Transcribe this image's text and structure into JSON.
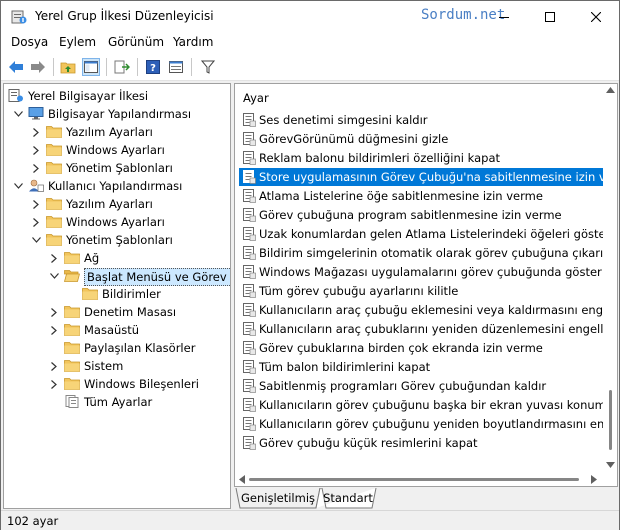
{
  "window": {
    "title": "Yerel Grup İlkesi Düzenleyicisi",
    "watermark": "Sordum.net"
  },
  "menu": [
    {
      "label": "Dosya"
    },
    {
      "label": "Eylem"
    },
    {
      "label": "Görünüm"
    },
    {
      "label": "Yardım"
    }
  ],
  "tree": {
    "items": [
      {
        "label": "Yerel Bilgisayar İlkesi"
      },
      {
        "label": "Bilgisayar Yapılandırması"
      },
      {
        "label": "Yazılım Ayarları"
      },
      {
        "label": "Windows Ayarları"
      },
      {
        "label": "Yönetim Şablonları"
      },
      {
        "label": "Kullanıcı Yapılandırması"
      },
      {
        "label": "Yazılım Ayarları"
      },
      {
        "label": "Windows Ayarları"
      },
      {
        "label": "Yönetim Şablonları"
      },
      {
        "label": "Ağ"
      },
      {
        "label": "Başlat Menüsü ve Görev Çubuğu"
      },
      {
        "label": "Bildirimler"
      },
      {
        "label": "Denetim Masası"
      },
      {
        "label": "Masaüstü"
      },
      {
        "label": "Paylaşılan Klasörler"
      },
      {
        "label": "Sistem"
      },
      {
        "label": "Windows Bileşenleri"
      },
      {
        "label": "Tüm Ayarlar"
      }
    ]
  },
  "list": {
    "header": "Ayar",
    "rows": [
      {
        "label": "Ses denetimi simgesini kaldır"
      },
      {
        "label": "GörevGörünümü düğmesini gizle"
      },
      {
        "label": "Reklam balonu bildirimleri özelliğini kapat"
      },
      {
        "label": "Store uygulamasının Görev Çubuğu'na sabitlenmesine izin verme"
      },
      {
        "label": "Atlama Listelerine öğe sabitlenmesine izin verme"
      },
      {
        "label": "Görev çubuğuna program sabitlenmesine izin verme"
      },
      {
        "label": "Uzak konumlardan gelen Atlama Listelerindeki öğeleri gösterme"
      },
      {
        "label": "Bildirim simgelerinin otomatik olarak görev çubuğuna çıkarılması"
      },
      {
        "label": "Windows Mağazası uygulamalarını görev çubuğunda göster"
      },
      {
        "label": "Tüm görev çubuğu ayarlarını kilitle"
      },
      {
        "label": "Kullanıcıların araç çubuğu eklemesini veya kaldırmasını engelle"
      },
      {
        "label": "Kullanıcıların araç çubuklarını yeniden düzenlemesini engelle"
      },
      {
        "label": "Görev çubuklarına birden çok ekranda izin verme"
      },
      {
        "label": "Tüm balon bildirimlerini kapat"
      },
      {
        "label": "Sabitlenmiş programları Görev çubuğundan kaldır"
      },
      {
        "label": "Kullanıcıların görev çubuğunu başka bir ekran yuvası konumuna"
      },
      {
        "label": "Kullanıcıların görev çubuğunu yeniden boyutlandırmasını engelle"
      },
      {
        "label": "Görev çubuğu küçük resimlerini kapat"
      }
    ]
  },
  "tabs": [
    {
      "label": "Genişletilmiş"
    },
    {
      "label": "Standart"
    }
  ],
  "status": {
    "text": "102 ayar"
  },
  "colors": {
    "selection": "#0078d7",
    "tree_selection": "#cce8ff",
    "folder": "#f2c55c",
    "accent": "#4a7fc4"
  }
}
